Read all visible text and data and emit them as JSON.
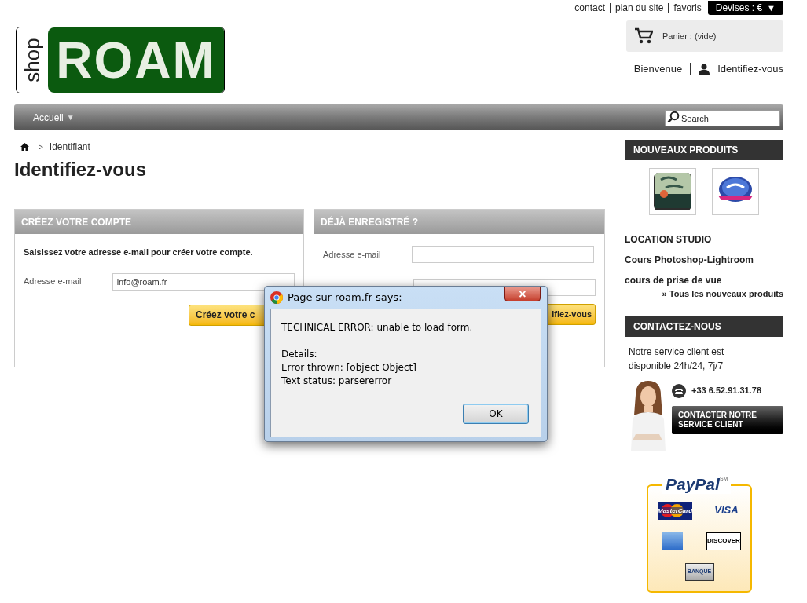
{
  "top_links": [
    "contact",
    "plan du site",
    "favoris"
  ],
  "currency": {
    "label": "Devises : €",
    "arrow": "▼"
  },
  "logo": {
    "small": "shop",
    "big": "ROAM"
  },
  "cart": {
    "label": "Panier : (vide)"
  },
  "account": {
    "welcome": "Bienvenue",
    "login": "Identifiez-vous"
  },
  "nav": {
    "items": [
      {
        "label": "Accueil",
        "caret": "▼"
      }
    ],
    "search": {
      "placeholder": "Search"
    }
  },
  "breadcrumb": {
    "separator": ">",
    "current": "Identifiant"
  },
  "page_title": "Identifiez-vous",
  "create_account": {
    "title": "CRÉEZ VOTRE COMPTE",
    "intro": "Saisissez votre adresse e-mail pour créer votre compte.",
    "email_label": "Adresse e-mail",
    "email_value": "info@roam.fr",
    "button": "Créez votre c"
  },
  "login_panel": {
    "title": "DÉJÀ ENREGISTRÉ ?",
    "email_label": "Adresse e-mail",
    "button": "ifiez-vous"
  },
  "new_products": {
    "title": "NOUVEAUX PRODUITS",
    "items": [
      "LOCATION STUDIO",
      "Cours Photoshop-Lightroom",
      "cours de prise de vue"
    ],
    "all_link": "» Tous les nouveaux produits"
  },
  "contact": {
    "title": "CONTACTEZ-NOUS",
    "text": "Notre service client est disponible 24h/24, 7j/7",
    "phone": "+33 6.52.91.31.78",
    "button": "CONTACTER NOTRE SERVICE CLIENT"
  },
  "paypal": {
    "logo": "PayPal",
    "tm": "SM",
    "cards": [
      {
        "kind": "mastercard",
        "label": "MasterCard"
      },
      {
        "kind": "visa",
        "label": "VISA"
      },
      {
        "kind": "amex"
      },
      {
        "kind": "discover",
        "label": "DISCOVER"
      },
      {
        "kind": "bank",
        "label": "BANQUE"
      }
    ]
  },
  "dialog": {
    "title": "Page sur roam.fr says:",
    "paragraphs": [
      [
        "TECHNICAL ERROR: unable to load form."
      ],
      [
        "Details:",
        "Error thrown: [object Object]",
        "Text status: parsererror"
      ]
    ],
    "button": "OK",
    "close": "×"
  }
}
